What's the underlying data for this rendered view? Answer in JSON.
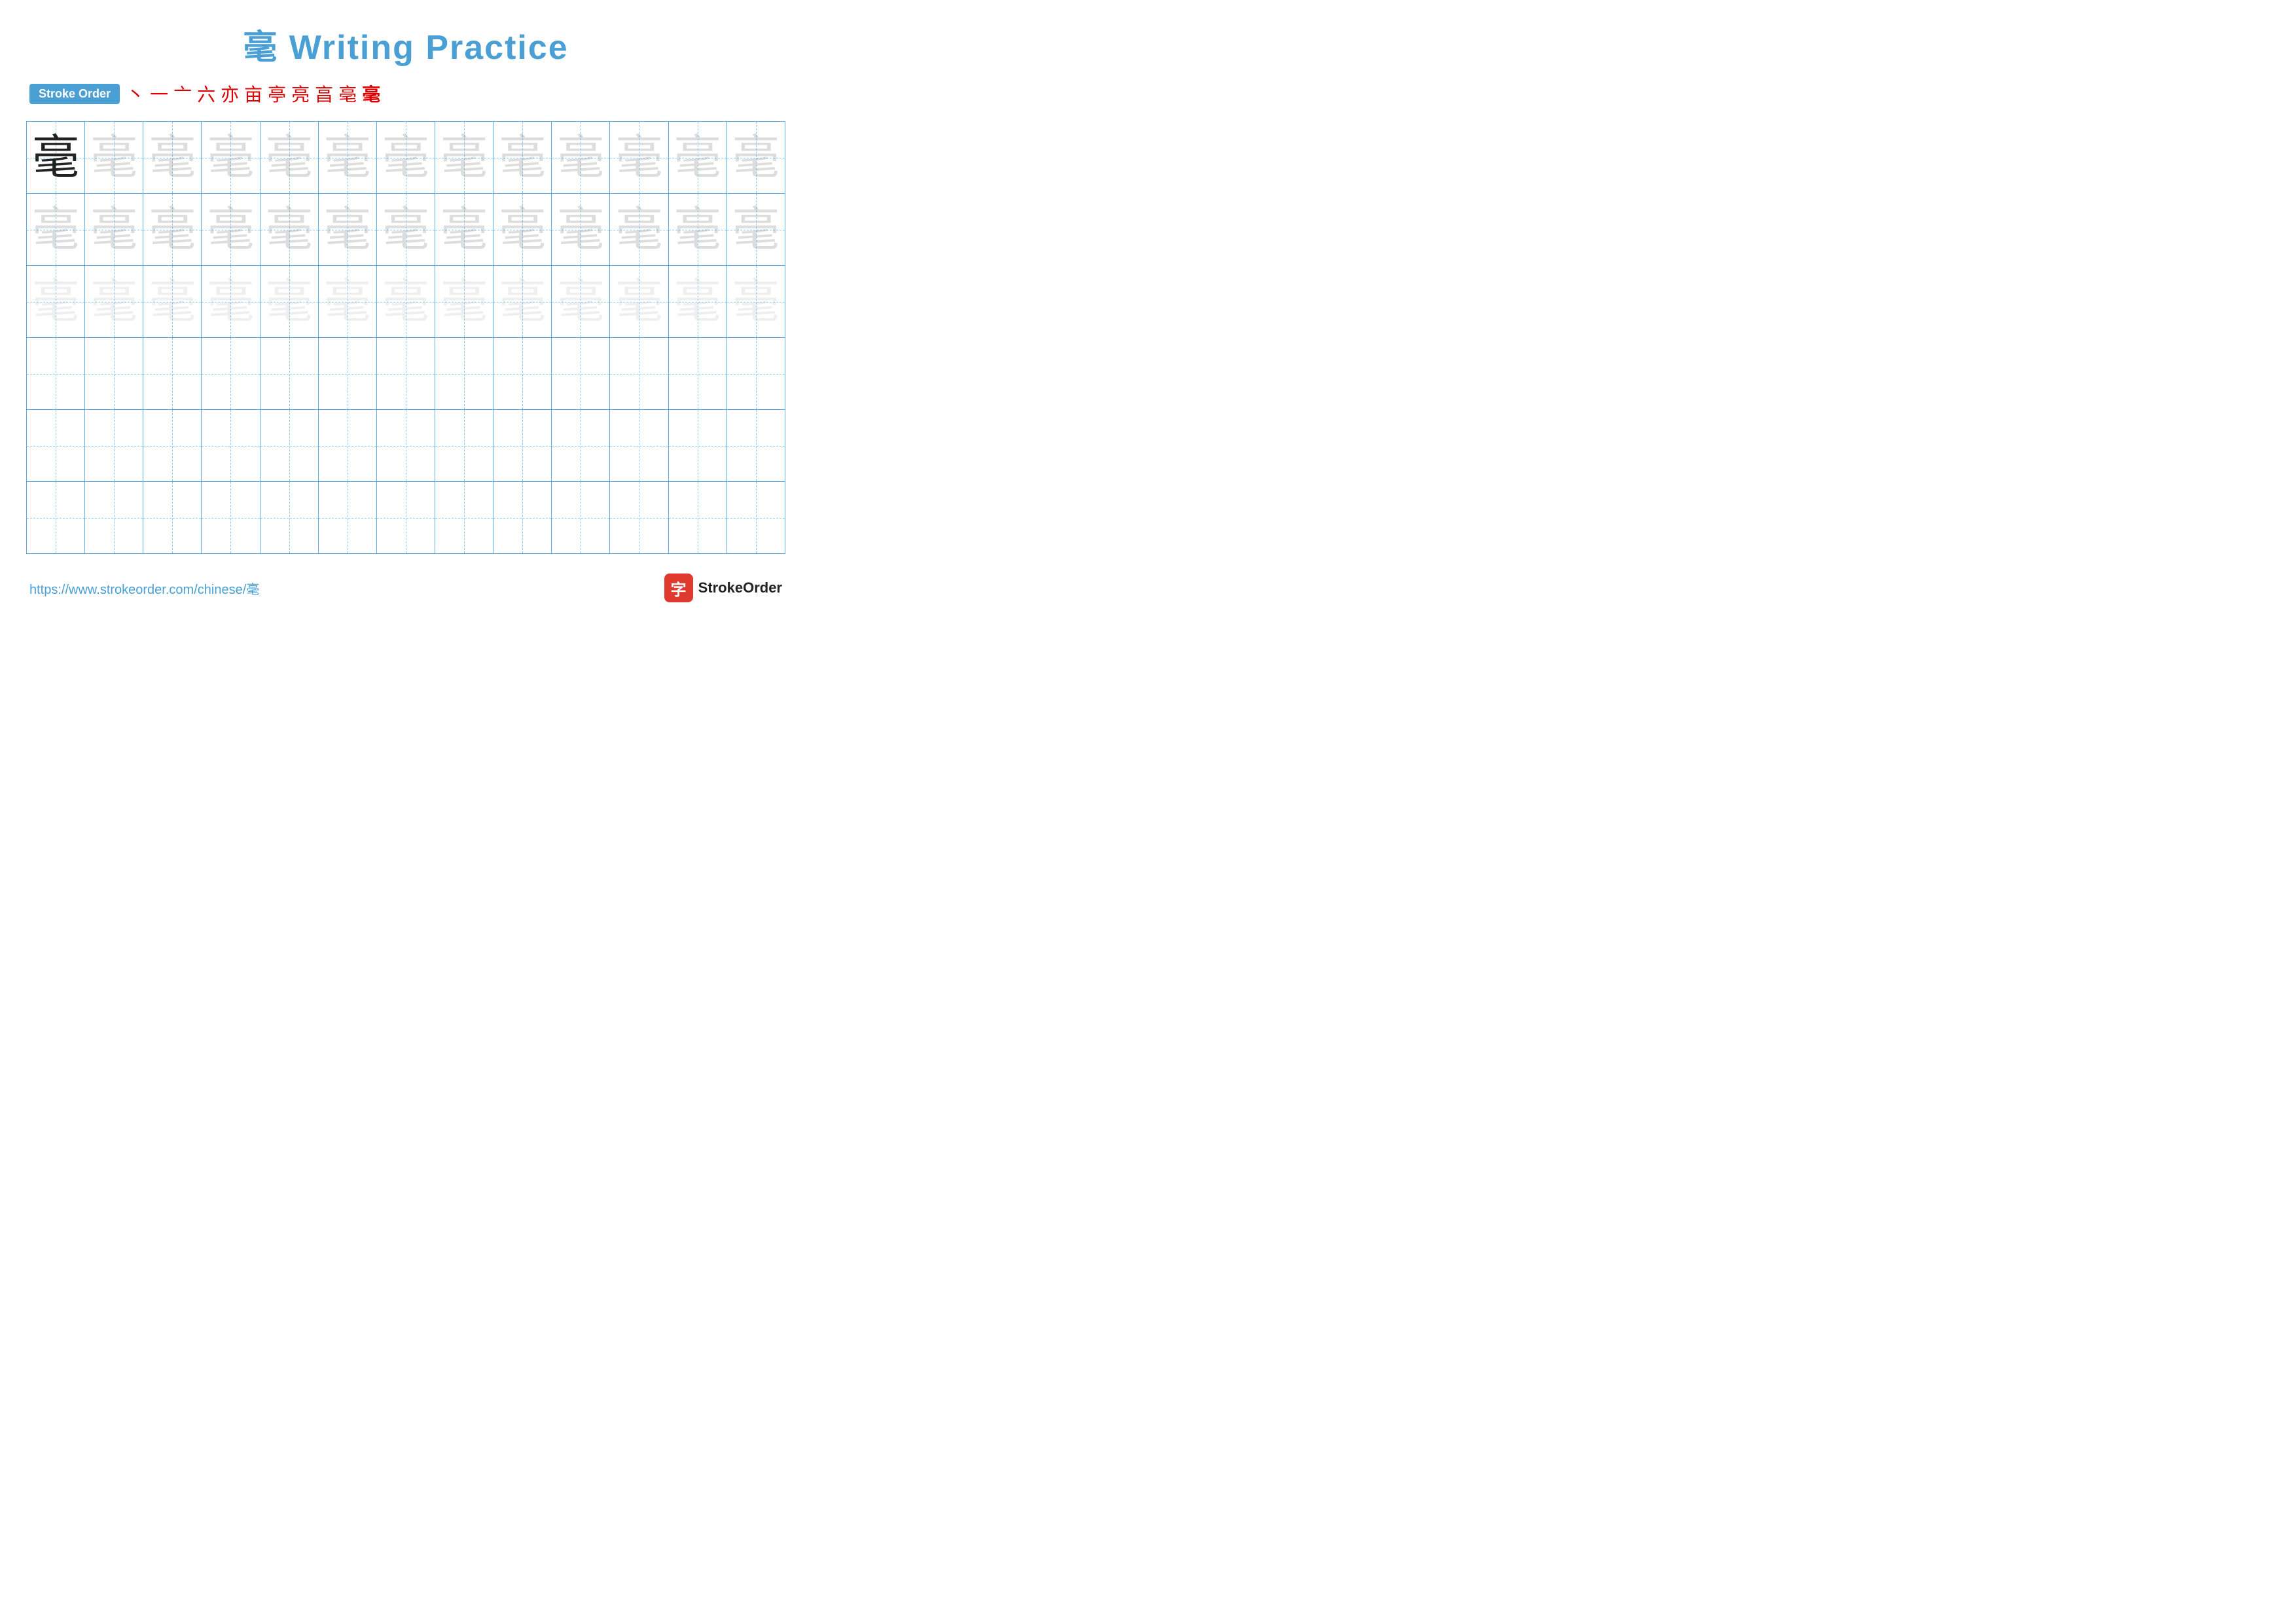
{
  "title": {
    "character": "毫",
    "text": "Writing Practice",
    "full": "毫 Writing Practice"
  },
  "stroke_order": {
    "badge_label": "Stroke Order",
    "strokes": [
      "丶",
      "一",
      "亠",
      "六",
      "亦",
      "亩",
      "亭",
      "亮",
      "亯",
      "亳",
      "毫"
    ]
  },
  "grid": {
    "character": "毫",
    "rows": 6,
    "cols": 13,
    "row_types": [
      "solid_then_faint_dark",
      "faint_dark",
      "faint_light",
      "empty",
      "empty",
      "empty"
    ]
  },
  "footer": {
    "url": "https://www.strokeorder.com/chinese/毫",
    "brand_name": "StrokeOrder",
    "brand_icon": "字"
  }
}
